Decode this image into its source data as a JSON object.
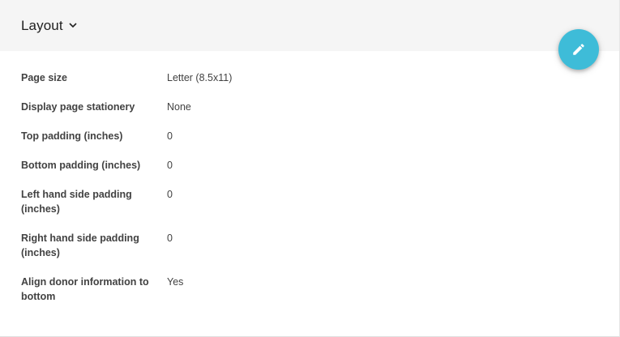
{
  "header": {
    "title": "Layout"
  },
  "fab": {
    "icon": "pencil-icon",
    "color": "#3ebcd8"
  },
  "fields": [
    {
      "label": "Page size",
      "value": "Letter (8.5x11)"
    },
    {
      "label": "Display page stationery",
      "value": "None"
    },
    {
      "label": "Top padding (inches)",
      "value": "0"
    },
    {
      "label": "Bottom padding (inches)",
      "value": "0"
    },
    {
      "label": "Left hand side padding (inches)",
      "value": "0"
    },
    {
      "label": "Right hand side padding (inches)",
      "value": "0"
    },
    {
      "label": "Align donor information to bottom",
      "value": "Yes"
    }
  ]
}
